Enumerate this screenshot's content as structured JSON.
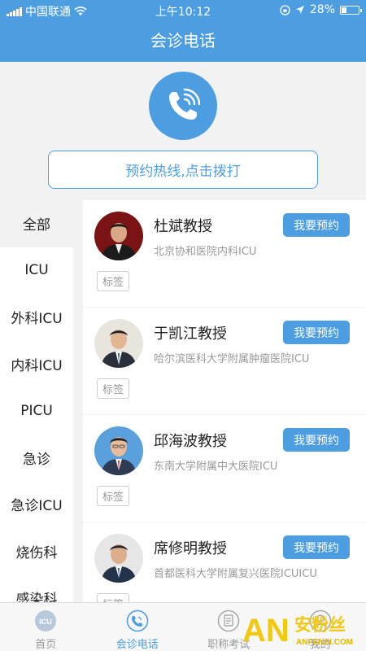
{
  "status_bar": {
    "carrier": "中国联通",
    "time": "上午10:12",
    "battery": "28%",
    "battery_level": 0.28
  },
  "nav": {
    "title": "会诊电话"
  },
  "hotline": {
    "label": "预约热线,点击拨打"
  },
  "sidebar": {
    "categories": [
      {
        "label": "全部"
      },
      {
        "label": "ICU"
      },
      {
        "label": "外科ICU"
      },
      {
        "label": "内科ICU"
      },
      {
        "label": "PICU"
      },
      {
        "label": "急诊"
      },
      {
        "label": "急诊ICU"
      },
      {
        "label": "烧伤科"
      },
      {
        "label": "感染科"
      }
    ]
  },
  "doctors": [
    {
      "name": "杜斌教授",
      "hospital": "北京协和医院内科ICU",
      "reserve": "我要预约",
      "tag": "标签"
    },
    {
      "name": "于凯江教授",
      "hospital": "哈尔滨医科大学附属肿瘤医院ICU",
      "reserve": "我要预约",
      "tag": "标签"
    },
    {
      "name": "邱海波教授",
      "hospital": "东南大学附属中大医院ICU",
      "reserve": "我要预约",
      "tag": "标签"
    },
    {
      "name": "席修明教授",
      "hospital": "首都医科大学附属复兴医院ICUICU",
      "reserve": "我要预约",
      "tag": "标签"
    }
  ],
  "tabbar": {
    "tabs": [
      {
        "label": "首页",
        "icon": "icu-icon"
      },
      {
        "label": "会诊电话",
        "icon": "phone-icon"
      },
      {
        "label": "职称考试",
        "icon": "exam-icon"
      },
      {
        "label": "我的",
        "icon": "user-icon"
      }
    ]
  },
  "watermark": {
    "text": "安粉丝",
    "sub": "ANFENSI.COM"
  },
  "colors": {
    "primary": "#4d9ee0",
    "background": "#f2f2f2"
  }
}
